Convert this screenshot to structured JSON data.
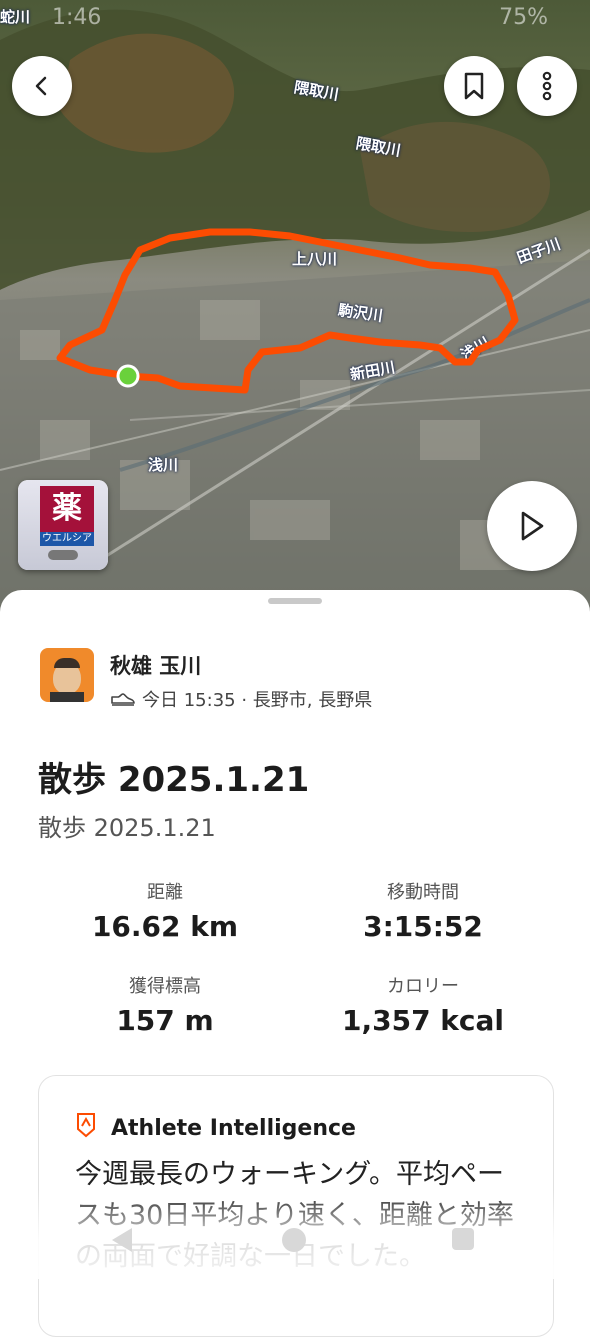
{
  "status_bar": {
    "time": "1:46",
    "battery": "75%"
  },
  "map": {
    "labels": [
      "蛇川",
      "隈取川",
      "隈取川",
      "田子川",
      "上八川",
      "駒沢川",
      "新田川",
      "浅川",
      "浅川"
    ],
    "photo_thumbnail": {
      "sign_text": "薬",
      "store_text": "ウエルシア"
    }
  },
  "header": {
    "back_icon": "chevron-left-icon",
    "bookmark_icon": "bookmark-icon",
    "more_icon": "more-vertical-icon"
  },
  "play_icon": "play-icon",
  "activity": {
    "athlete": "秋雄 玉川",
    "meta": "今日 15:35 · 長野市, 長野県",
    "title": "散歩 2025.1.21",
    "description": "散歩 2025.1.21",
    "stats": [
      {
        "label": "距離",
        "value": "16.62 km"
      },
      {
        "label": "移動時間",
        "value": "3:15:52"
      },
      {
        "label": "獲得標高",
        "value": "157 m"
      },
      {
        "label": "カロリー",
        "value": "1,357 kcal"
      }
    ]
  },
  "ai_card": {
    "title": "Athlete Intelligence",
    "text": "今週最長のウォーキング。平均ペースも30日平均より速く、距離と効率の両面で好調な一日でした。"
  },
  "colors": {
    "route": "#fc4c02",
    "start_marker": "#6ad13b"
  }
}
